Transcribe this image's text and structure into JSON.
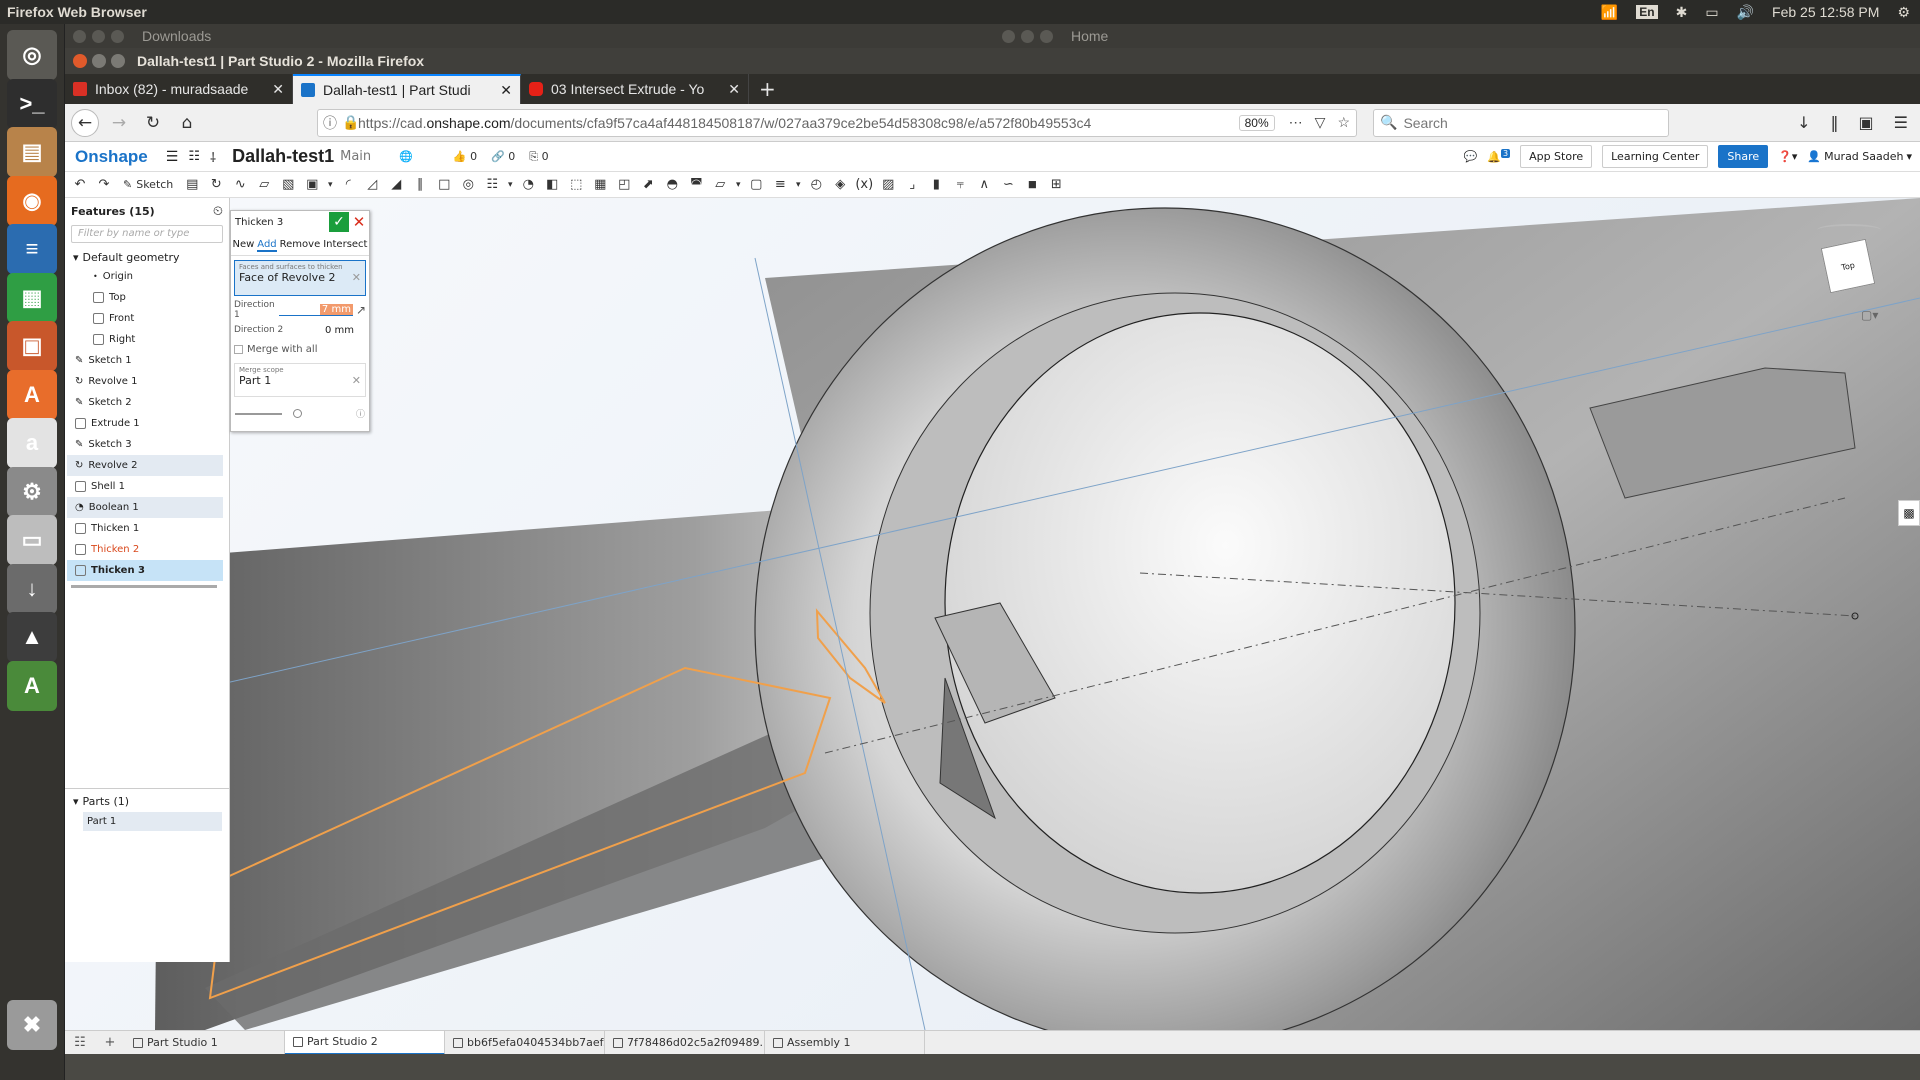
{
  "system": {
    "app_title": "Firefox Web Browser",
    "input_lang": "En",
    "datetime": "Feb 25 12:58 PM",
    "bg_window_1": "Downloads",
    "bg_window_2": "Home"
  },
  "launcher": [
    {
      "name": "ubuntu-dash-icon",
      "color": "#5a5954"
    },
    {
      "name": "terminal-icon",
      "color": "#2e2e2e"
    },
    {
      "name": "files-icon",
      "color": "#b8834a"
    },
    {
      "name": "firefox-icon",
      "color": "#e66b1f"
    },
    {
      "name": "writer-icon",
      "color": "#2b6cb0"
    },
    {
      "name": "calc-icon",
      "color": "#2f9e44"
    },
    {
      "name": "impress-icon",
      "color": "#c8572b"
    },
    {
      "name": "software-center-icon",
      "color": "#e86d2b"
    },
    {
      "name": "amazon-icon",
      "color": "#e3e3e3"
    },
    {
      "name": "settings-icon",
      "color": "#8a8a8a"
    },
    {
      "name": "disk-icon",
      "color": "#bdbdbd"
    },
    {
      "name": "usb-icon",
      "color": "#6b6b6b"
    },
    {
      "name": "inkscape-icon",
      "color": "#3d3d3d"
    },
    {
      "name": "updater-icon",
      "color": "#4a8a3a"
    },
    {
      "name": "trash-icon",
      "color": "#9a9a9a"
    }
  ],
  "window": {
    "title": "Dallah-test1 | Part Studio 2 - Mozilla Firefox"
  },
  "tabs": [
    {
      "label": "Inbox (82) - muradsaade",
      "favcolor": "#d93025"
    },
    {
      "label": "Dallah-test1 | Part Studi",
      "favcolor": "#1a73c8"
    },
    {
      "label": "03 Intersect Extrude - Yo",
      "favcolor": "#e62117"
    }
  ],
  "nav": {
    "url_prefix": "https://cad.",
    "url_domain": "onshape.com",
    "url_rest": "/documents/cfa9f57ca4af448184508187/w/027aa379ce2be54d58308c98/e/a572f80b49553c4",
    "zoom": "80%",
    "search_placeholder": "Search"
  },
  "onshape": {
    "logo": "Onshape",
    "doc_name": "Dallah-test1",
    "branch": "Main",
    "likes": "0",
    "links": "0",
    "copies": "0",
    "notif_count": "3",
    "app_store": "App Store",
    "learning_center": "Learning Center",
    "share": "Share",
    "user": "Murad Saadeh",
    "sketch_label": "Sketch"
  },
  "features": {
    "header": "Features (15)",
    "filter_placeholder": "Filter by name or type",
    "default_geometry": "Default geometry",
    "defaults": [
      "Origin",
      "Top",
      "Front",
      "Right"
    ],
    "items": [
      {
        "label": "Sketch 1",
        "state": ""
      },
      {
        "label": "Revolve 1",
        "state": ""
      },
      {
        "label": "Sketch 2",
        "state": ""
      },
      {
        "label": "Extrude 1",
        "state": ""
      },
      {
        "label": "Sketch 3",
        "state": ""
      },
      {
        "label": "Revolve 2",
        "state": "hl"
      },
      {
        "label": "Shell 1",
        "state": ""
      },
      {
        "label": "Boolean 1",
        "state": "hl"
      },
      {
        "label": "Thicken 1",
        "state": ""
      },
      {
        "label": "Thicken 2",
        "state": "err"
      },
      {
        "label": "Thicken 3",
        "state": "sel"
      }
    ],
    "parts_header": "Parts (1)",
    "parts": [
      "Part 1"
    ]
  },
  "dialog": {
    "title": "Thicken 3",
    "tabs": [
      "New",
      "Add",
      "Remove",
      "Intersect"
    ],
    "active_tab": "Add",
    "faces_caption": "Faces and surfaces to thicken",
    "faces_value": "Face of Revolve 2",
    "dir1_label": "Direction 1",
    "dir1_value": "7 mm",
    "dir2_label": "Direction 2",
    "dir2_value": "0 mm",
    "merge_label": "Merge with all",
    "scope_caption": "Merge scope",
    "scope_value": "Part 1"
  },
  "viewcube": {
    "face_label": "Top"
  },
  "bottom_tabs": [
    {
      "label": "Part Studio 1",
      "active": false
    },
    {
      "label": "Part Studio 2",
      "active": true
    },
    {
      "label": "bb6f5efa0404534bb7aef...",
      "active": false
    },
    {
      "label": "7f78486d02c5a2f09489...",
      "active": false
    },
    {
      "label": "Assembly 1",
      "active": false
    }
  ]
}
